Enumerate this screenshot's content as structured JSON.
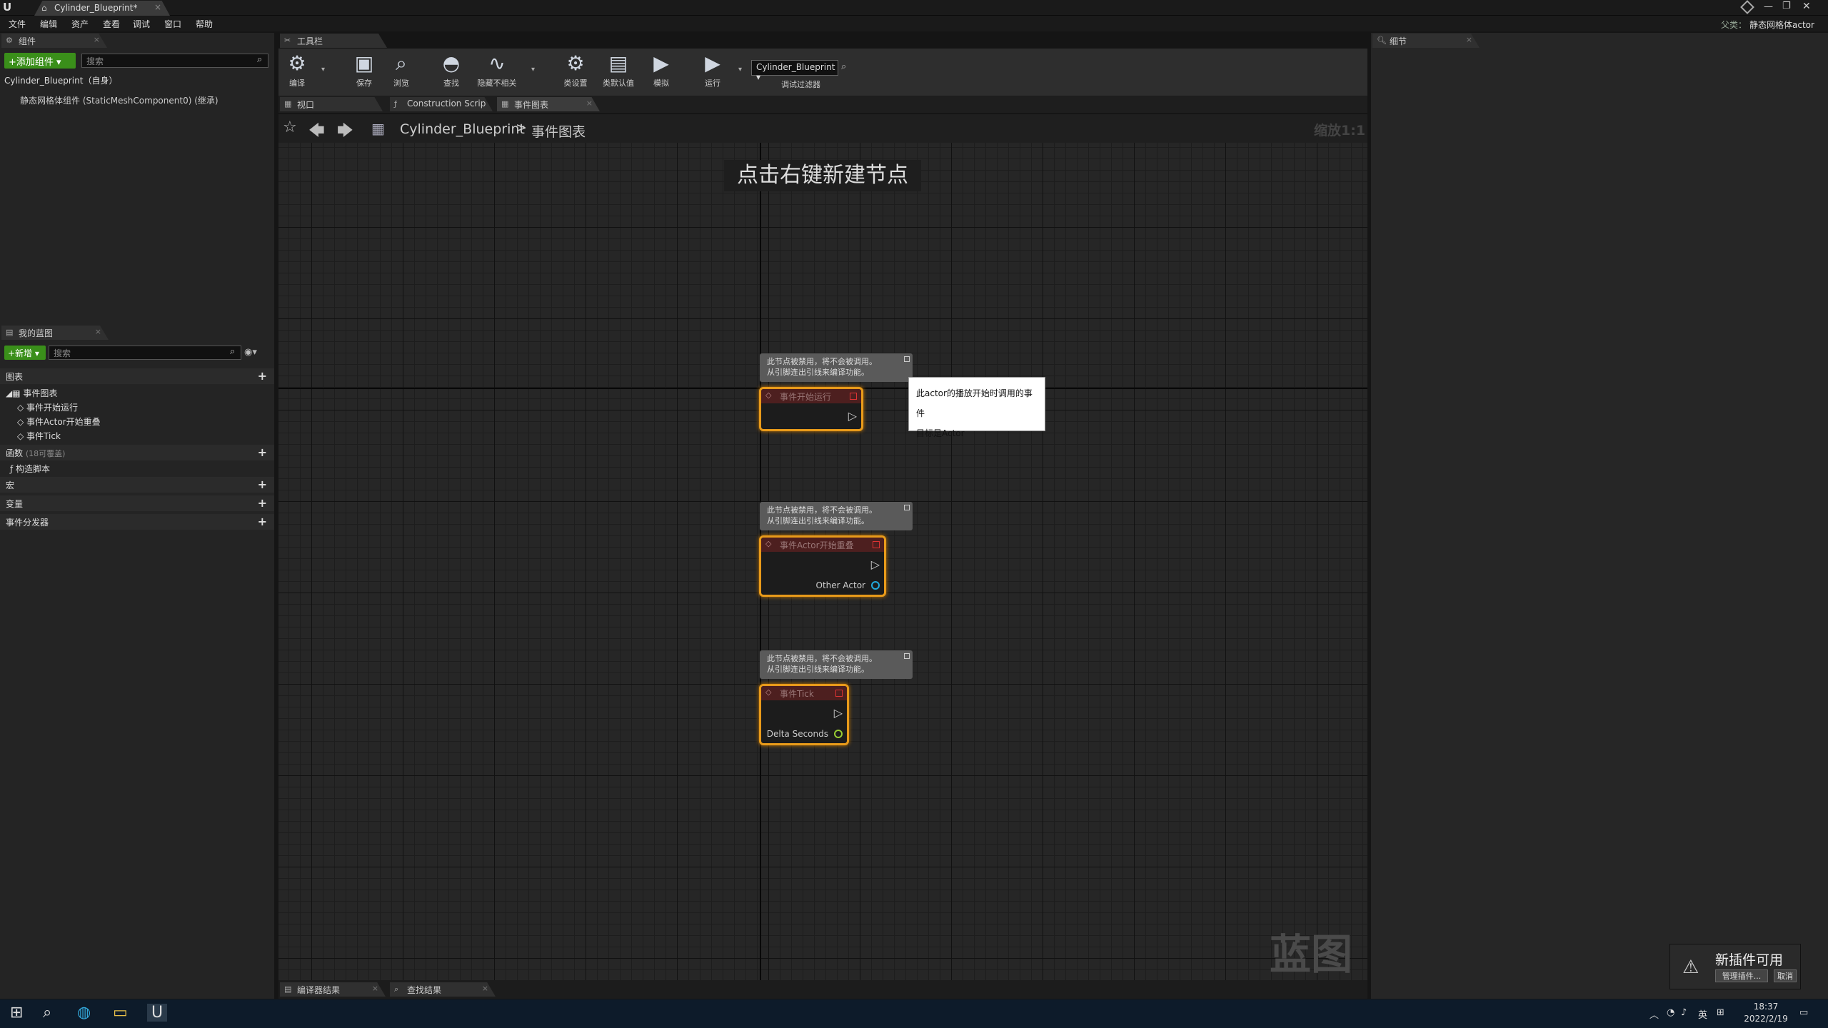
{
  "window": {
    "doc_tab": "Cylinder_Blueprint*",
    "parent_prefix": "父类：",
    "parent_label": "静态网格体actor"
  },
  "menu": [
    "文件",
    "编辑",
    "资产",
    "查看",
    "调试",
    "窗口",
    "帮助"
  ],
  "components": {
    "tab": "组件",
    "add_button": "+添加组件 ▾",
    "search_placeholder": "搜索",
    "root": "Cylinder_Blueprint（自身）",
    "child": "静态网格体组件 (StaticMeshComponent0) (继承)"
  },
  "my_blueprint": {
    "tab": "我的蓝图",
    "new_button": "+新增 ▾",
    "search_placeholder": "搜索",
    "graphs_label": "图表",
    "event_graph": "事件图表",
    "events": [
      "事件开始运行",
      "事件Actor开始重叠",
      "事件Tick"
    ],
    "functions_label": "函数",
    "functions_count": "(18可覆盖)",
    "construction_script": "构造脚本",
    "macros_label": "宏",
    "variables_label": "变量",
    "dispatchers_label": "事件分发器"
  },
  "toolbar": {
    "tab": "工具栏",
    "compile": "编译",
    "save": "保存",
    "browse": "浏览",
    "find": "查找",
    "hide_unrelated": "隐藏不相关",
    "class_settings": "类设置",
    "class_defaults": "类默认值",
    "simulate": "模拟",
    "play": "运行",
    "debug_object": "Cylinder_Blueprint ▾",
    "debug_filter": "调试过滤器"
  },
  "editor_tabs": [
    "视口",
    "Construction Scrip",
    "事件图表"
  ],
  "graph": {
    "breadcrumb_bp": "Cylinder_Blueprint",
    "breadcrumb_sep": ">",
    "breadcrumb_graph": "事件图表",
    "zoom": "缩放1:1",
    "hint": "点击右键新建节点",
    "watermark": "蓝图",
    "disabled_comment_1": "此节点被禁用，将不会被调用。",
    "disabled_comment_2": "从引脚连出引线来编译功能。",
    "nodes": [
      {
        "title": "事件开始运行",
        "pin": ""
      },
      {
        "title": "事件Actor开始重叠",
        "pin": "Other Actor"
      },
      {
        "title": "事件Tick",
        "pin": "Delta Seconds"
      }
    ],
    "tooltip_line1": "此actor的播放开始时调用的事件",
    "tooltip_line2": "目标是Actor"
  },
  "details": {
    "tab": "细节"
  },
  "bottom_tabs": [
    "编译器结果",
    "查找结果"
  ],
  "notification": {
    "title": "新插件可用",
    "manage": "管理插件...",
    "cancel": "取消"
  },
  "taskbar": {
    "time": "18:37",
    "date": "2022/2/19",
    "lang": "英"
  }
}
